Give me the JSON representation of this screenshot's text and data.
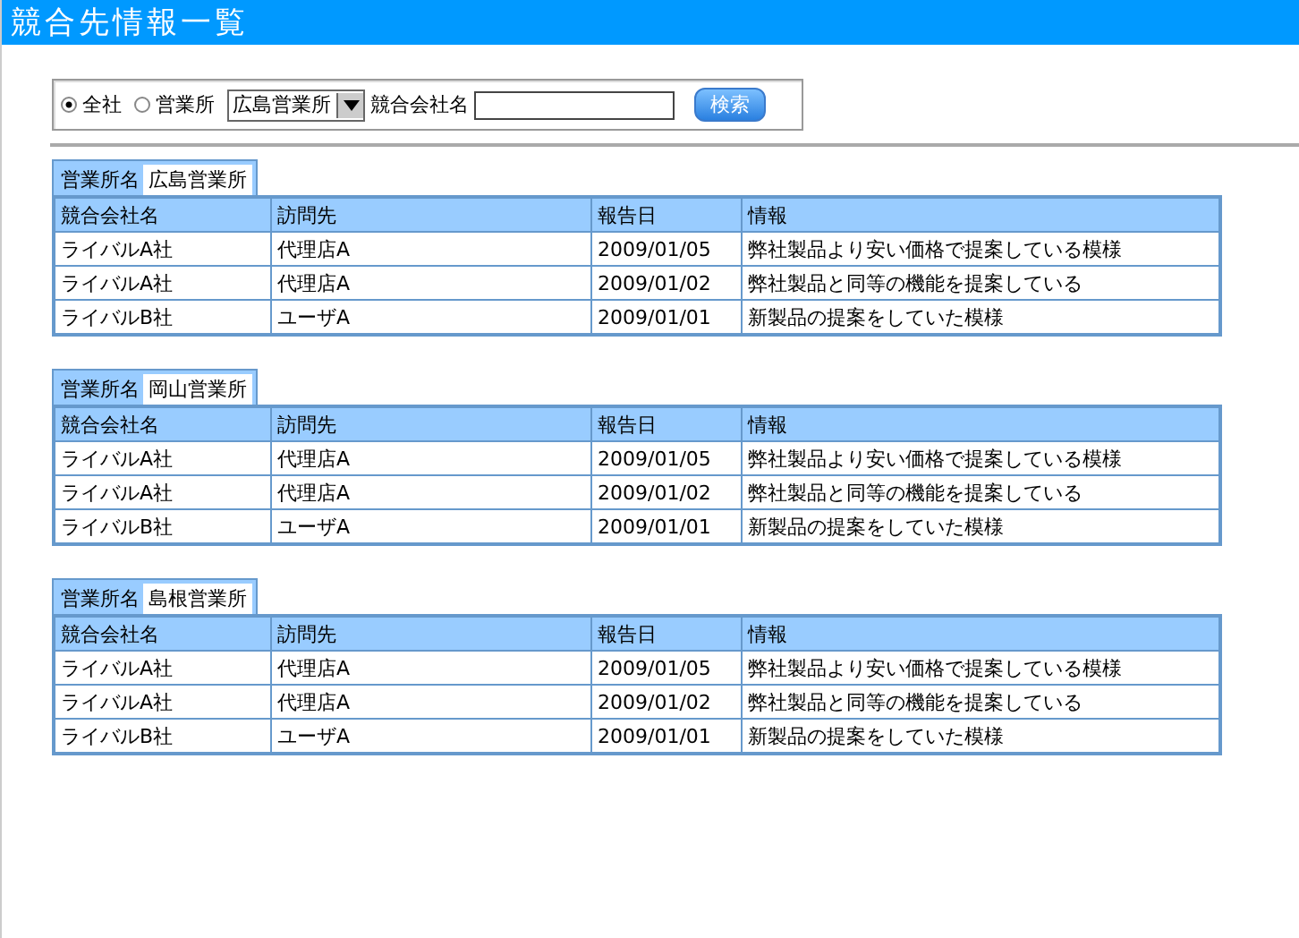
{
  "title": "競合先情報一覧",
  "search": {
    "scope_options": [
      {
        "label": "全社",
        "selected": true
      },
      {
        "label": "営業所",
        "selected": false
      }
    ],
    "office_select": "広島営業所",
    "company_label": "競合会社名",
    "button": "検索"
  },
  "sections": [
    {
      "office_label": "営業所名",
      "office": "広島営業所",
      "columns": [
        "競合会社名",
        "訪問先",
        "報告日",
        "情報"
      ],
      "rows": [
        [
          "ライバルA社",
          "代理店A",
          "2009/01/05",
          "弊社製品より安い価格で提案している模様"
        ],
        [
          "ライバルA社",
          "代理店A",
          "2009/01/02",
          "弊社製品と同等の機能を提案している"
        ],
        [
          "ライバルB社",
          "ユーザA",
          "2009/01/01",
          "新製品の提案をしていた模様"
        ]
      ]
    },
    {
      "office_label": "営業所名",
      "office": "岡山営業所",
      "columns": [
        "競合会社名",
        "訪問先",
        "報告日",
        "情報"
      ],
      "rows": [
        [
          "ライバルA社",
          "代理店A",
          "2009/01/05",
          "弊社製品より安い価格で提案している模様"
        ],
        [
          "ライバルA社",
          "代理店A",
          "2009/01/02",
          "弊社製品と同等の機能を提案している"
        ],
        [
          "ライバルB社",
          "ユーザA",
          "2009/01/01",
          "新製品の提案をしていた模様"
        ]
      ]
    },
    {
      "office_label": "営業所名",
      "office": "島根営業所",
      "columns": [
        "競合会社名",
        "訪問先",
        "報告日",
        "情報"
      ],
      "rows": [
        [
          "ライバルA社",
          "代理店A",
          "2009/01/05",
          "弊社製品より安い価格で提案している模様"
        ],
        [
          "ライバルA社",
          "代理店A",
          "2009/01/02",
          "弊社製品と同等の機能を提案している"
        ],
        [
          "ライバルB社",
          "ユーザA",
          "2009/01/01",
          "新製品の提案をしていた模様"
        ]
      ]
    }
  ]
}
